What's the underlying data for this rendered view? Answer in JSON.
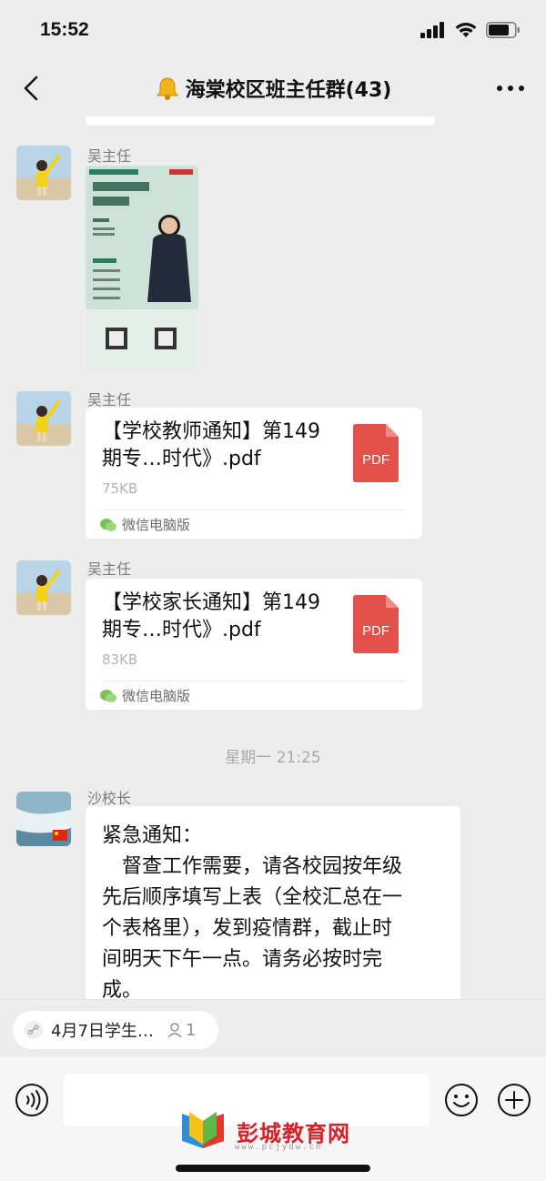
{
  "status_bar": {
    "time": "15:52"
  },
  "nav": {
    "title": "海棠校区班主任群(43)"
  },
  "messages": [
    {
      "sender": "吴主任",
      "type": "image"
    },
    {
      "sender": "吴主任",
      "type": "file",
      "file_name": "【学校教师通知】第149期专…时代》.pdf",
      "file_size": "75KB",
      "file_icon_label": "PDF",
      "source": "微信电脑版"
    },
    {
      "sender": "吴主任",
      "type": "file",
      "file_name": "【学校家长通知】第149期专…时代》.pdf",
      "file_size": "83KB",
      "file_icon_label": "PDF",
      "source": "微信电脑版"
    }
  ],
  "timestamp": "星期一 21:25",
  "last_message": {
    "sender": "沙校长",
    "lines": [
      "紧急通知：",
      "　督查工作需要，请各校园按年级",
      "先后顺序填写上表（全校汇总在一",
      "个表格里），发到疫情群，截止时",
      "间明天下午一点。请务必按时完",
      "成。"
    ]
  },
  "reference": {
    "label": "4月7日学生…",
    "count": "1"
  },
  "watermark": {
    "text": "彭城教育网",
    "url": "www.pcjydw.cn"
  },
  "colors": {
    "background": "#ededed",
    "pdf_red": "#e2514a",
    "wechat_green": "#7bc25a",
    "watermark_red": "#d2232a"
  }
}
